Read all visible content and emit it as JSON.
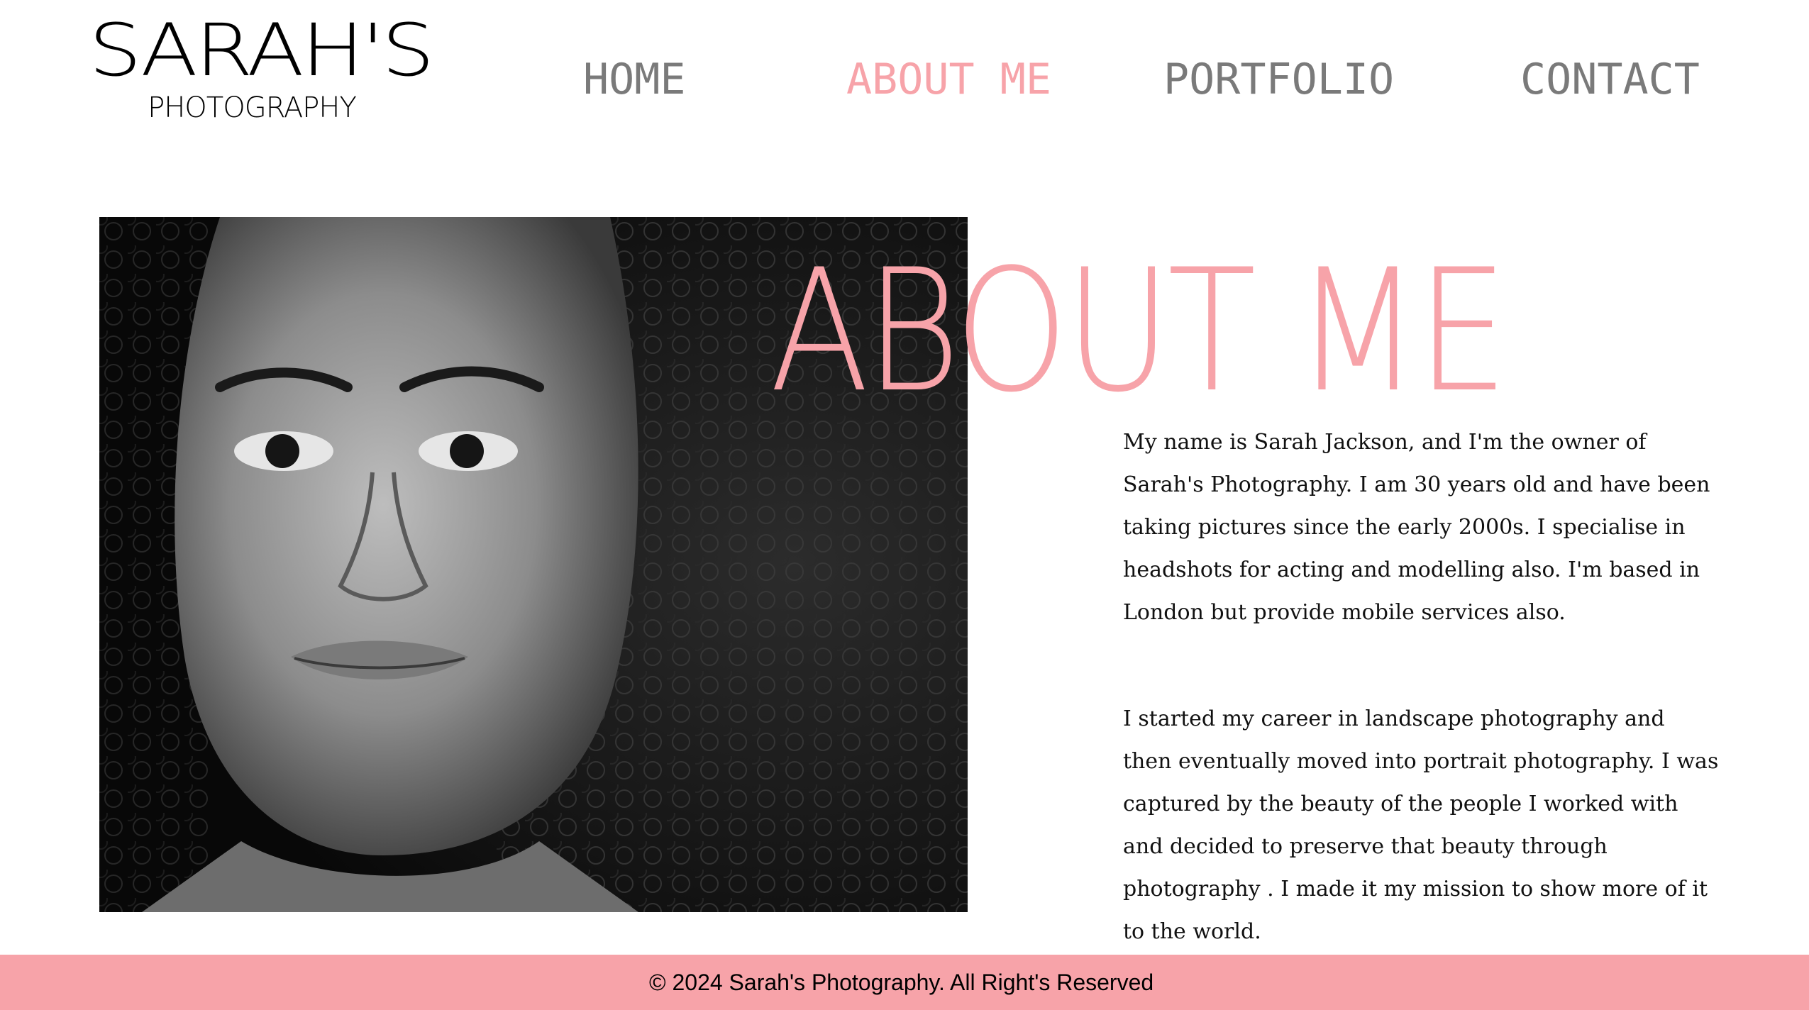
{
  "brand": {
    "name": "SARAH'S",
    "tagline": "PHOTOGRAPHY"
  },
  "nav": {
    "items": [
      {
        "label": "HOME",
        "active": false
      },
      {
        "label": "ABOUT ME",
        "active": true
      },
      {
        "label": "PORTFOLIO",
        "active": false
      },
      {
        "label": "CONTACT",
        "active": false
      }
    ]
  },
  "about": {
    "heading": "ABOUT ME",
    "paragraphs": [
      "My name is Sarah Jackson, and I'm the owner of Sarah's Photography. I am 30 years old and have been taking pictures since the early 2000s. I specialise in headshots for acting and modelling also. I'm based in London but provide mobile services also.",
      "I started my career in landscape photography and then eventually moved into portrait photography. I was captured by the beauty of the people I worked with and decided to preserve that beauty through photography . I made it my mission to show more of it to the world."
    ]
  },
  "footer": {
    "copyright": "© 2024 Sarah's Photography. All Right's Reserved"
  },
  "colors": {
    "accent": "#f7a3a9",
    "nav_inactive": "#7a7a7a",
    "background": "#ffffff",
    "text": "#111111"
  }
}
